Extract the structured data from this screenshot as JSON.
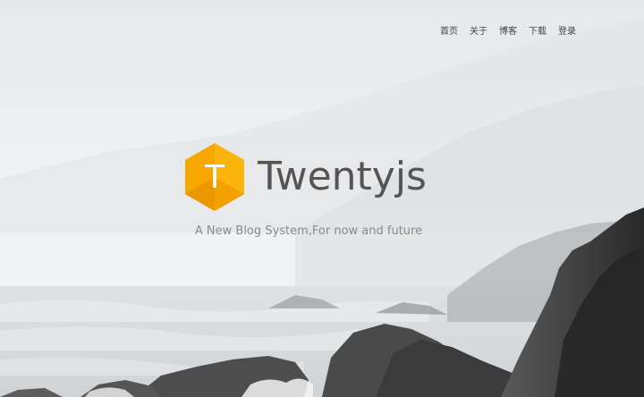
{
  "nav": {
    "items": [
      {
        "label": "首页"
      },
      {
        "label": "关于"
      },
      {
        "label": "博客"
      },
      {
        "label": "下载"
      },
      {
        "label": "登录"
      }
    ]
  },
  "hero": {
    "logo_letter": "T",
    "brand_name": "Twentyjs",
    "tagline": "A New Blog System,For now and future"
  },
  "colors": {
    "accent": "#f5a300",
    "accent_dark": "#e08a00",
    "brand_text": "#555555",
    "tagline_text": "#8a8a8a",
    "rock_dark": "#2e2e2e"
  }
}
